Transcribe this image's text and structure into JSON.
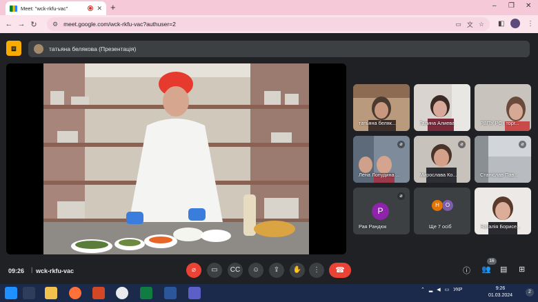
{
  "browser": {
    "tab_title": "Meet: \"wck-rkfu-vac\"",
    "tab_close": "✕",
    "new_tab": "+",
    "url": "meet.google.com/wck-rkfu-vac?authuser=2",
    "win_min": "–",
    "win_max": "❐",
    "win_close": "✕"
  },
  "header": {
    "presentation_label": "тaтьяна белякова (Презентація)"
  },
  "participants": [
    {
      "name": "тaтьяна беляк...",
      "muted": false
    },
    {
      "name": "Галина Алиева",
      "muted": false
    },
    {
      "name": "РВПУ РС і торг...",
      "muted": false
    },
    {
      "name": "Лена Лопудина ...",
      "muted": true
    },
    {
      "name": "Мирослава Ко...",
      "muted": true
    },
    {
      "name": "Станіслав Пав...",
      "muted": true
    },
    {
      "name": "Рая Рандюк",
      "muted": true,
      "initial": "Р"
    },
    {
      "name": "Ще 7 осіб",
      "muted": false,
      "initials": [
        "Н",
        "О"
      ]
    },
    {
      "name": "Наталія Борисе...",
      "muted": false
    }
  ],
  "controls": {
    "time": "09:26",
    "separator": "|",
    "meeting_code": "wck-rkfu-vac",
    "participant_count": "16"
  },
  "taskbar": {
    "lang": "УКР",
    "time": "9:26",
    "date": "01.03.2024",
    "notif": "2"
  },
  "colors": {
    "meet_bg": "#202124",
    "end_call": "#ea4335",
    "tab_bar": "#f6c9d9",
    "present_accent": "#f9ab00"
  }
}
